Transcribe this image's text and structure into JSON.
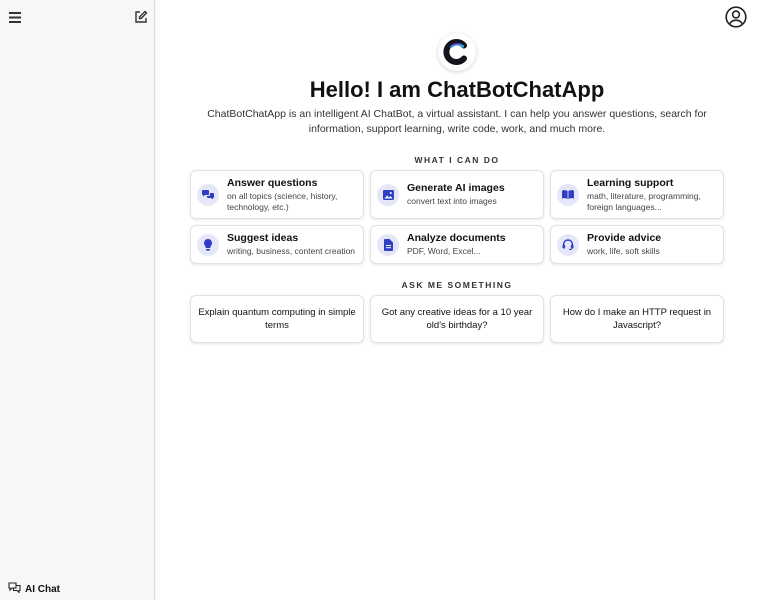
{
  "sidebar": {
    "footer_label": "AI Chat"
  },
  "hero": {
    "title": "Hello! I am ChatBotChatApp",
    "description": "ChatBotChatApp is an intelligent AI ChatBot, a virtual assistant. I can help you answer questions, search for information, support learning, write code, work, and much more."
  },
  "capabilities": {
    "heading": "WHAT I CAN DO",
    "items": [
      {
        "title": "Answer questions",
        "subtitle": "on all topics (science, history, technology, etc.)",
        "icon": "chat-bubbles-icon"
      },
      {
        "title": "Generate AI images",
        "subtitle": "convert text into images",
        "icon": "image-icon"
      },
      {
        "title": "Learning support",
        "subtitle": "math, literature, programming, foreign languages...",
        "icon": "book-icon"
      },
      {
        "title": "Suggest ideas",
        "subtitle": "writing, business, content creation",
        "icon": "lightbulb-icon"
      },
      {
        "title": "Analyze documents",
        "subtitle": "PDF, Word, Excel...",
        "icon": "document-icon"
      },
      {
        "title": "Provide advice",
        "subtitle": "work, life, soft skills",
        "icon": "headset-icon"
      }
    ]
  },
  "prompts": {
    "heading": "ASK ME SOMETHING",
    "items": [
      "Explain quantum computing in simple terms",
      "Got any creative ideas for a 10 year old's birthday?",
      "How do I make an HTTP request in Javascript?"
    ]
  },
  "colors": {
    "accent": "#2f3fc4",
    "icon_bg": "#e5e7f8",
    "sidebar_bg": "#f7f7f7"
  }
}
